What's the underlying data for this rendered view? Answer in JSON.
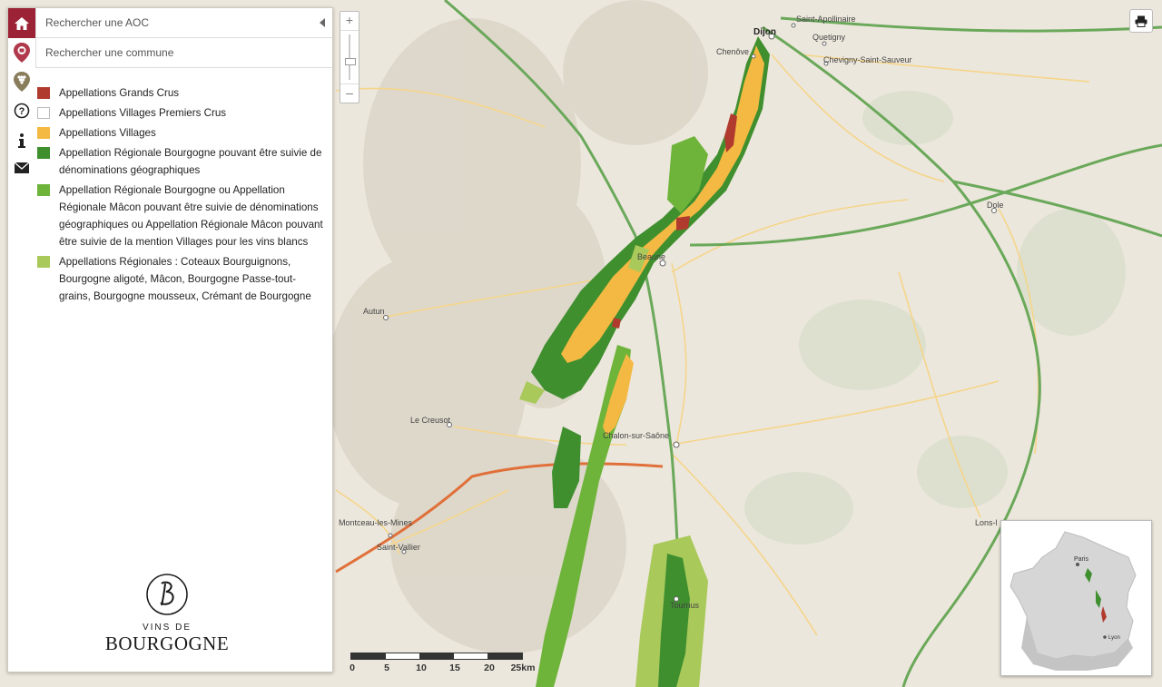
{
  "search": {
    "aoc_placeholder": "Rechercher une AOC",
    "commune_placeholder": "Rechercher une commune"
  },
  "legend": [
    {
      "label": "Appellations Grands Crus",
      "color": "#b13a2e"
    },
    {
      "label": "Appellations Villages Premiers Crus",
      "color": "#ffffff"
    },
    {
      "label": "Appellations Villages",
      "color": "#f4b942"
    },
    {
      "label": "Appellation Régionale Bourgogne pouvant être suivie de dénominations géographiques",
      "color": "#3f8f2f"
    },
    {
      "label": "Appellation Régionale Bourgogne ou Appellation Régionale Mâcon pouvant être suivie de dénominations géographiques ou Appellation Régionale Mâcon pouvant être suivie de la mention Villages pour les vins blancs",
      "color": "#6fb43a"
    },
    {
      "label": "Appellations Régionales : Coteaux Bourguignons, Bourgogne aligoté, Mâcon, Bourgogne Passe-tout-grains, Bourgogne mousseux, Crémant de Bourgogne",
      "color": "#a9c95a"
    }
  ],
  "logo": {
    "line1": "VINS DE",
    "line2": "BOURGOGNE"
  },
  "zoom": {
    "plus": "+",
    "minus": "–"
  },
  "scale": {
    "ticks": [
      "0",
      "5",
      "10",
      "15",
      "20",
      "25km"
    ]
  },
  "places": {
    "dijon": "Dijon",
    "saint_apollinaire": "Saint-Apollinaire",
    "quetigny": "Quetigny",
    "chevigny": "Chevigny-Saint-Sauveur",
    "chenove": "Chenôve",
    "beaune": "Beaune",
    "autun": "Autun",
    "le_creusot": "Le Creusot",
    "chalon": "Chalon-sur-Saône",
    "montceau": "Montceau-les-Mines",
    "saint_vallier": "Saint-Vallier",
    "tournus": "Tournus",
    "dole": "Dole",
    "lons": "Lons-l"
  },
  "inset": {
    "paris": "Paris",
    "lyon": "Lyon"
  },
  "colors": {
    "brand": "#9b2335",
    "map_bg": "#ece7dc",
    "highway": "#4f9a4d",
    "road": "#f0b34a",
    "motorway_orange": "#e0703a"
  }
}
